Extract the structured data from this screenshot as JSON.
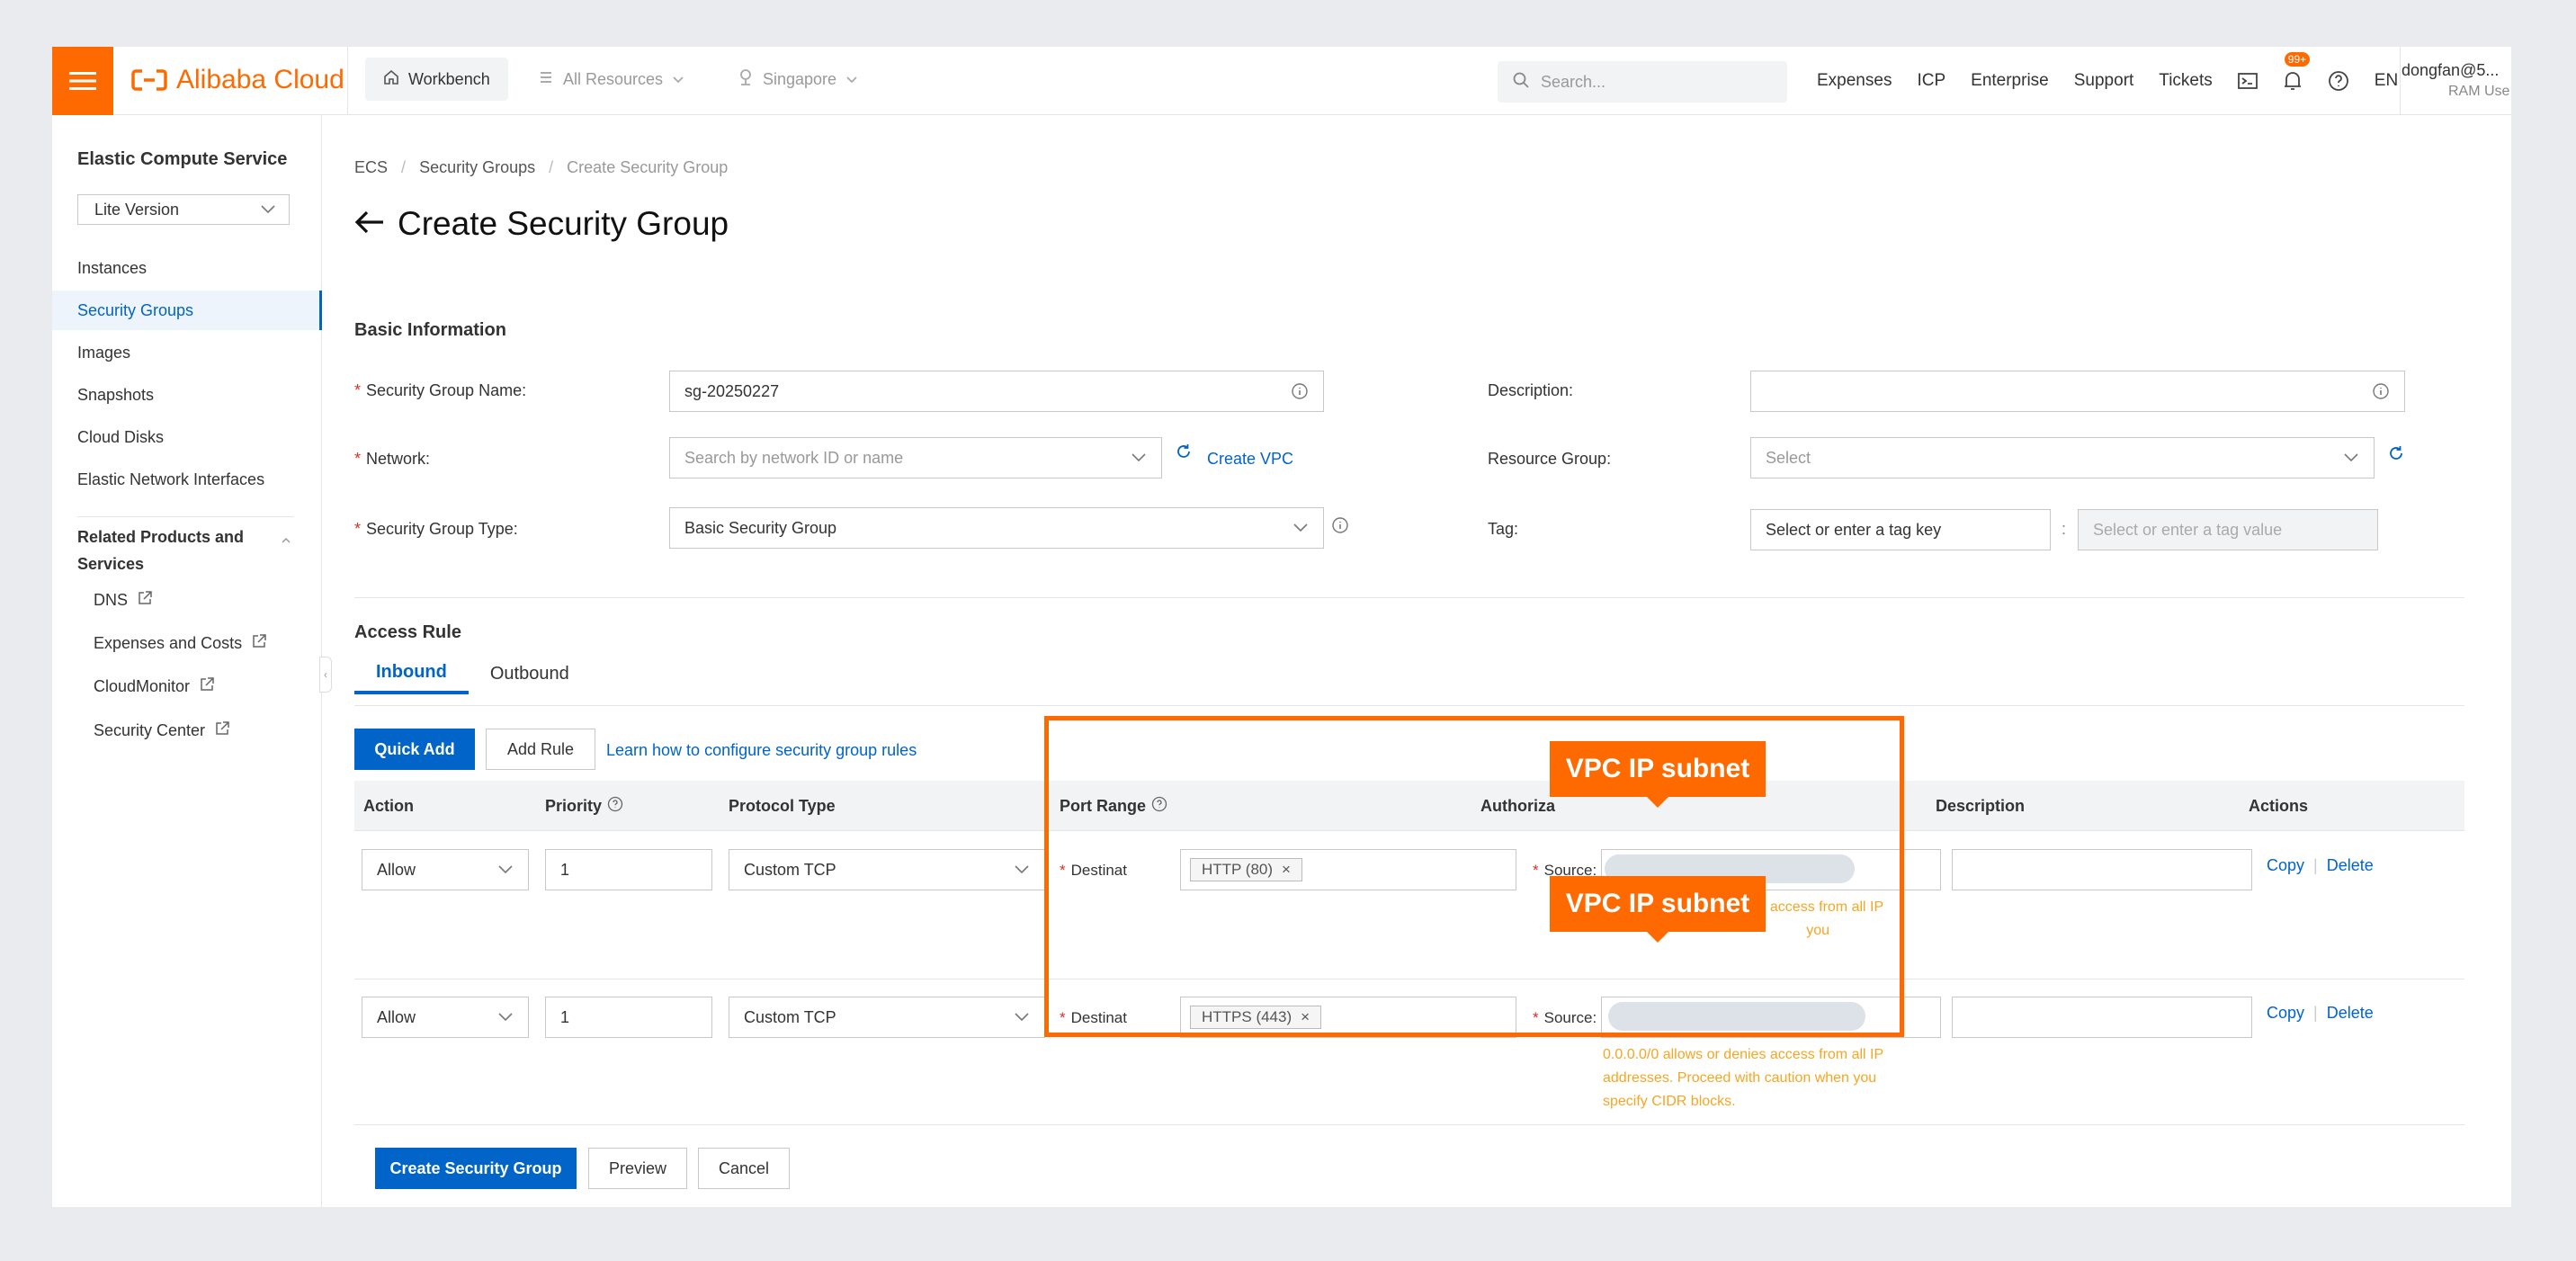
{
  "brand": {
    "name": "Alibaba Cloud",
    "accent": "#ff6a00",
    "primary": "#0064c8"
  },
  "topbar": {
    "workbench": "Workbench",
    "all_resources": "All Resources",
    "region": "Singapore",
    "search_placeholder": "Search...",
    "links": [
      "Expenses",
      "ICP",
      "Enterprise",
      "Support",
      "Tickets"
    ],
    "badge": "99+",
    "lang": "EN",
    "user_name": "dongfan@5...",
    "user_role": "RAM Use"
  },
  "sidebar": {
    "title": "Elastic Compute Service",
    "version": "Lite Version",
    "items": [
      "Instances",
      "Security Groups",
      "Images",
      "Snapshots",
      "Cloud Disks",
      "Elastic Network Interfaces"
    ],
    "active": "Security Groups",
    "related_title": "Related Products and Services",
    "related": [
      "DNS",
      "Expenses and Costs",
      "CloudMonitor",
      "Security Center"
    ]
  },
  "breadcrumb": [
    "ECS",
    "Security Groups",
    "Create Security Group"
  ],
  "page_title": "Create Security Group",
  "basic": {
    "title": "Basic Information",
    "name_label": "Security Group Name",
    "name_value": "sg-20250227",
    "network_label": "Network",
    "network_placeholder": "Search by network ID or name",
    "create_vpc": "Create VPC",
    "type_label": "Security Group Type",
    "type_value": "Basic Security Group",
    "desc_label": "Description",
    "rg_label": "Resource Group",
    "rg_placeholder": "Select",
    "tag_label": "Tag",
    "tag_key_placeholder": "Select or enter a tag key",
    "tag_value_placeholder": "Select or enter a tag value"
  },
  "access": {
    "title": "Access Rule",
    "tabs": [
      "Inbound",
      "Outbound"
    ],
    "quick_add": "Quick Add",
    "add_rule": "Add Rule",
    "learn_link": "Learn how to configure security group rules",
    "columns": [
      "Action",
      "Priority",
      "Protocol Type",
      "Port Range",
      "Authoriza",
      "Description",
      "Actions"
    ],
    "dest_label": "Destinat",
    "source_label": "Source",
    "copy": "Copy",
    "delete": "Delete",
    "rows": [
      {
        "action": "Allow",
        "priority": "1",
        "protocol": "Custom TCP",
        "port": "HTTP (80)",
        "warn": [
          "0.0.0.0/0 allows or denies access from all IP",
          "you"
        ]
      },
      {
        "action": "Allow",
        "priority": "1",
        "protocol": "Custom TCP",
        "port": "HTTPS (443)",
        "warn": [
          "0.0.0.0/0 allows or denies access from all IP",
          "addresses. Proceed with caution when you",
          "specify CIDR blocks."
        ]
      }
    ]
  },
  "annotation": {
    "callout_1": "VPC IP subnet",
    "callout_2": "VPC IP subnet"
  },
  "footer": {
    "create": "Create Security Group",
    "preview": "Preview",
    "cancel": "Cancel"
  }
}
